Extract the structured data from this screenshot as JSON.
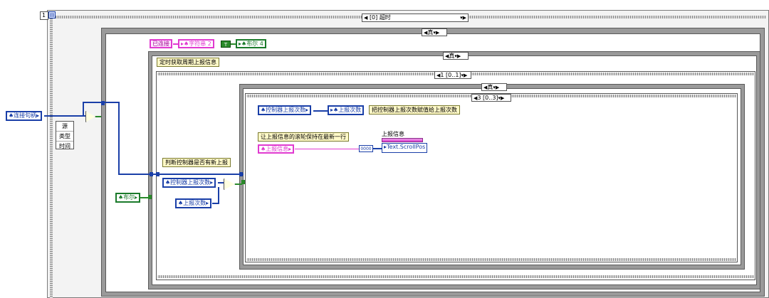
{
  "outer_frame": {
    "frame_number": "1",
    "icon": "sequence-icon"
  },
  "timeout_case": {
    "selector": "[0] 超时"
  },
  "case_true_1": "真",
  "case_true_2": "真",
  "case_true_3": "真",
  "seq_1": "1 [0..1]",
  "seq_3": "3 [0..3]",
  "connected_label": "已连接",
  "string2_local": "字符串 2",
  "bool_const": "T",
  "bool4_local": "布尔 4",
  "timer_label": "定时获取周期上报信息",
  "judge_label": "判断控制器是否有新上报",
  "assign_label": "把控制器上报次数赋值给上报次数",
  "scroll_label": "让上报信息的滚轮保持在最新一行",
  "conn_handle": "连接句柄",
  "unbundle": [
    "源",
    "类型",
    "时间"
  ],
  "bool_local": "布尔",
  "ctrl_report_count_a": "控制器上报次数",
  "ctrl_report_count_b": "控制器上报次数",
  "report_count_a": "上报次数",
  "report_count_b": "上报次数",
  "report_info_local": "上报信息",
  "prop_node_title": "上报信息",
  "prop_node_prop": "Text.ScrollPos",
  "numeric_const": "0000",
  "colors": {
    "i32": "#1a3fa8",
    "string": "#e03ad0",
    "boolean": "#2a8a2a"
  }
}
